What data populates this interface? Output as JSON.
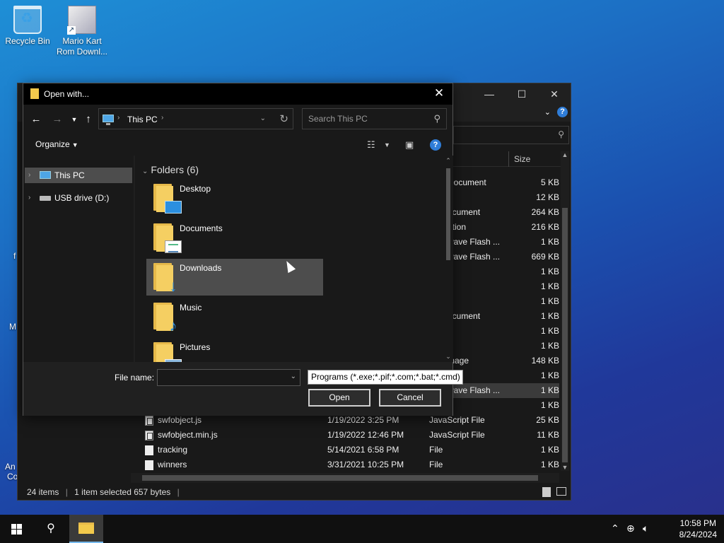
{
  "desktop": {
    "icons": [
      {
        "label": "Recycle Bin"
      },
      {
        "label": "Mario Kart Rom Downl..."
      }
    ],
    "fragments": [
      "f",
      "M",
      "An",
      "Co"
    ]
  },
  "explorer": {
    "size_header": "Size",
    "rows": [
      {
        "name": "",
        "date": "",
        "type": "Document",
        "size": "5 KB",
        "icon": ""
      },
      {
        "name": "",
        "date": "",
        "type": "e",
        "size": "12 KB",
        "icon": ""
      },
      {
        "name": "",
        "date": "",
        "type": "ocument",
        "size": "264 KB",
        "icon": ""
      },
      {
        "name": "",
        "date": "",
        "type": "ation",
        "size": "216 KB",
        "icon": ""
      },
      {
        "name": "",
        "date": "",
        "type": "wave Flash ...",
        "size": "1 KB",
        "icon": ""
      },
      {
        "name": "",
        "date": "",
        "type": "wave Flash ...",
        "size": "669 KB",
        "icon": ""
      },
      {
        "name": "",
        "date": "",
        "type": "",
        "size": "1 KB",
        "icon": ""
      },
      {
        "name": "",
        "date": "",
        "type": "",
        "size": "1 KB",
        "icon": ""
      },
      {
        "name": "",
        "date": "",
        "type": "",
        "size": "1 KB",
        "icon": ""
      },
      {
        "name": "",
        "date": "",
        "type": "ocument",
        "size": "1 KB",
        "icon": ""
      },
      {
        "name": "",
        "date": "",
        "type": "",
        "size": "1 KB",
        "icon": ""
      },
      {
        "name": "",
        "date": "",
        "type": "",
        "size": "1 KB",
        "icon": ""
      },
      {
        "name": "",
        "date": "",
        "type": "mage",
        "size": "148 KB",
        "icon": ""
      },
      {
        "name": "",
        "date": "",
        "type": "",
        "size": "1 KB",
        "icon": ""
      },
      {
        "name": "",
        "date": "",
        "type": "wave Flash ...",
        "size": "1 KB",
        "icon": "",
        "selected": true
      },
      {
        "name": "",
        "date": "",
        "type": "",
        "size": "1 KB",
        "icon": ""
      },
      {
        "name": "swfobject.js",
        "date": "1/19/2022 3:25 PM",
        "type": "JavaScript File",
        "size": "25 KB",
        "icon": "js"
      },
      {
        "name": "swfobject.min.js",
        "date": "1/19/2022 12:46 PM",
        "type": "JavaScript File",
        "size": "11 KB",
        "icon": "js"
      },
      {
        "name": "tracking",
        "date": "5/14/2021 6:58 PM",
        "type": "File",
        "size": "1 KB",
        "icon": "file"
      },
      {
        "name": "winners",
        "date": "3/31/2021 10:25 PM",
        "type": "File",
        "size": "1 KB",
        "icon": "file"
      }
    ],
    "status": {
      "items": "24 items",
      "selected": "1 item selected  657 bytes"
    }
  },
  "dialog": {
    "title": "Open with...",
    "address": {
      "location": "This PC"
    },
    "search_placeholder": "Search This PC",
    "organize_label": "Organize",
    "nav": [
      {
        "label": "This PC",
        "icon": "computer-icon",
        "selected": true
      },
      {
        "label": "USB drive (D:)",
        "icon": "usb-drive-icon",
        "selected": false
      }
    ],
    "group_header": "Folders (6)",
    "folders": [
      {
        "label": "Desktop",
        "badge": "desktop"
      },
      {
        "label": "Documents",
        "badge": "docs"
      },
      {
        "label": "Downloads",
        "badge": "down",
        "hover": true
      },
      {
        "label": "Music",
        "badge": "music"
      },
      {
        "label": "Pictures",
        "badge": "pics"
      }
    ],
    "file_name_label": "File name:",
    "file_name_value": "",
    "filter": "Programs (*.exe;*.pif;*.com;*.bat;*.cmd)",
    "open_label": "Open",
    "cancel_label": "Cancel"
  },
  "taskbar": {
    "time": "10:58 PM",
    "date": "8/24/2024"
  },
  "colors": {
    "accent": "#2f7dd8",
    "folder": "#f5cf62",
    "selection": "#4d4d4d"
  }
}
